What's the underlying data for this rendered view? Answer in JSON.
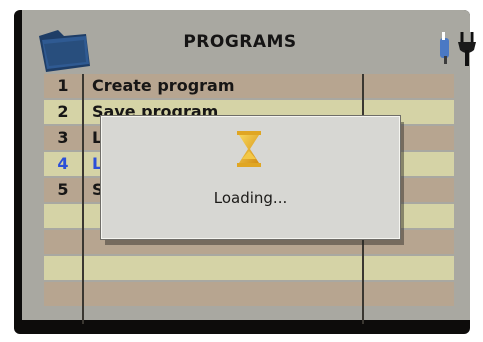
{
  "header": {
    "title": "PROGRAMS",
    "left_icon": "folder-icon",
    "right_icon": "plug-cable-icon"
  },
  "programs": {
    "items": [
      {
        "number": "1",
        "label": "Create program",
        "selected": false
      },
      {
        "number": "2",
        "label": "Save program",
        "selected": false
      },
      {
        "number": "3",
        "label": "L",
        "selected": false
      },
      {
        "number": "4",
        "label": "L",
        "selected": true
      },
      {
        "number": "5",
        "label": "S",
        "selected": false
      }
    ]
  },
  "dialog": {
    "icon": "hourglass-icon",
    "message": "Loading..."
  },
  "colors": {
    "selected_text": "#2b4fd8",
    "row_odd": "#b7a590",
    "row_even": "#d5d3a6",
    "panel": "#a9a8a1",
    "dialog_bg": "#d7d7d3"
  }
}
